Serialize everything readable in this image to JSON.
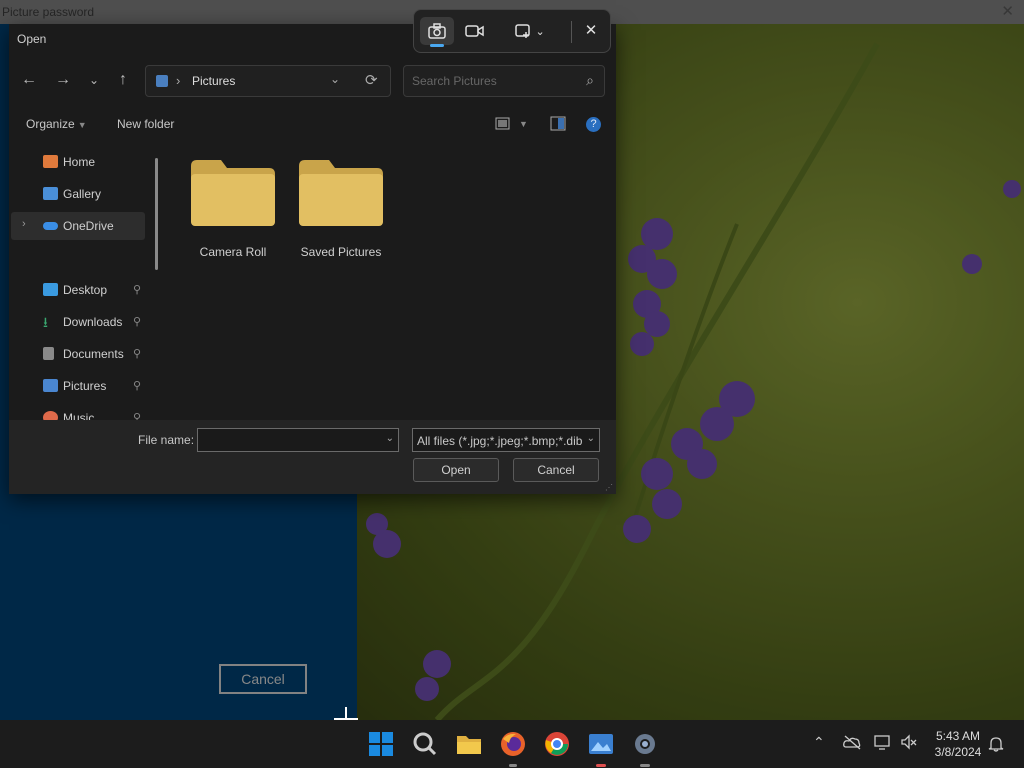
{
  "background_app": {
    "title": "Picture password",
    "close_glyph": "✕",
    "cancel_label": "Cancel"
  },
  "dialog": {
    "title": "Open",
    "nav": {
      "back": "←",
      "forward": "→",
      "recent": "⌄",
      "up": "↑"
    },
    "address": {
      "separator": "›",
      "location": "Pictures",
      "chevron": "⌄",
      "refresh": "⟳"
    },
    "search_placeholder": "Search Pictures",
    "search_icon": "⌕",
    "toolbar": {
      "organize": "Organize",
      "new_folder": "New folder",
      "help": "?"
    },
    "sidebar": [
      {
        "label": "Home",
        "icon": "home-icon",
        "color": "#e07a3c",
        "pinned": false
      },
      {
        "label": "Gallery",
        "icon": "gallery-icon",
        "color": "#4a8fd8",
        "pinned": false
      },
      {
        "label": "OneDrive",
        "icon": "onedrive-icon",
        "color": "#3a8ee6",
        "pinned": false,
        "selected": true,
        "expand": "›"
      },
      {
        "label": "Desktop",
        "icon": "desktop-icon",
        "color": "#3a9ae0",
        "pinned": true
      },
      {
        "label": "Downloads",
        "icon": "downloads-icon",
        "color": "#3aa870",
        "pinned": true
      },
      {
        "label": "Documents",
        "icon": "documents-icon",
        "color": "#8a8a8a",
        "pinned": true
      },
      {
        "label": "Pictures",
        "icon": "pictures-icon",
        "color": "#4a86d0",
        "pinned": true
      },
      {
        "label": "Music",
        "icon": "music-icon",
        "color": "#e06a4a",
        "pinned": true
      }
    ],
    "pin_glyph": "📌",
    "folders": [
      {
        "label": "Camera Roll"
      },
      {
        "label": "Saved Pictures"
      }
    ],
    "file_name_label": "File name:",
    "file_name_value": "",
    "file_type": "All files (*.jpg;*.jpeg;*.bmp;*.dib",
    "open_label": "Open",
    "cancel_label": "Cancel"
  },
  "snipping_toolbar": {
    "photo_icon": "📷",
    "video_icon": "video-icon",
    "mode_icon": "rectangle-mode-icon",
    "mode_chevron": "⌄",
    "close": "✕",
    "accent": "#4aa8f0"
  },
  "taskbar": {
    "tray_chevron": "⌃",
    "time": "5:43 AM",
    "date": "3/8/2024",
    "notification": "🔔"
  }
}
